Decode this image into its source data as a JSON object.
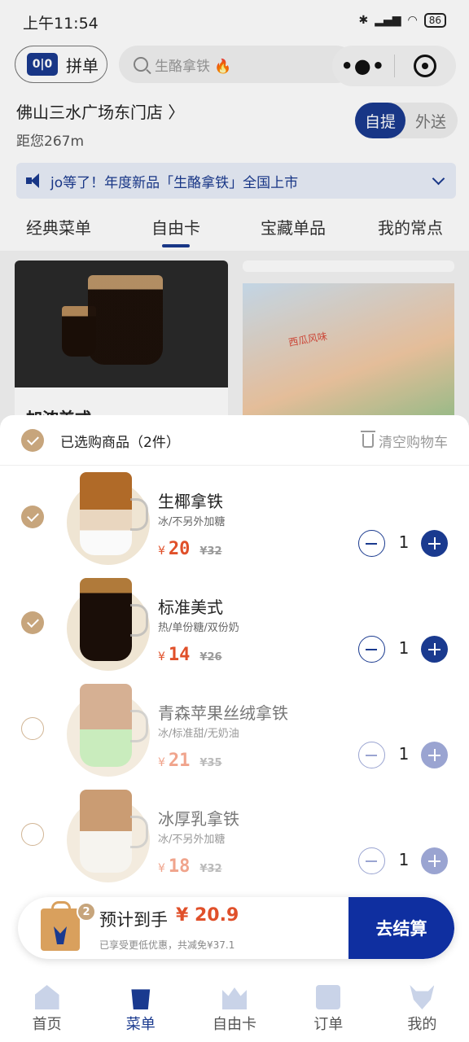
{
  "status_bar": {
    "time": "上午11:54",
    "battery": "86"
  },
  "header": {
    "pin_logo": "0|0",
    "pin_label": "拼单",
    "search_placeholder": "生酪拿铁 🔥",
    "capsule_more": "•●•",
    "store_name": "佛山三水广场东门店 〉",
    "distance": "距您267m",
    "mode_selected": "自提",
    "mode_other": "外送",
    "notice": "jo等了！年度新品「生酪拿铁」全国上市",
    "accent_color": "#1a3a8f"
  },
  "tabs": [
    {
      "label": "经典菜单"
    },
    {
      "label": "自由卡"
    },
    {
      "label": "宝藏单品"
    },
    {
      "label": "我的常点"
    }
  ],
  "background_cards": {
    "card1_name": "加浓美式",
    "card2_text": "西瓜风味"
  },
  "cart": {
    "title": "已选购商品（2件）",
    "clear_label": "清空购物车",
    "items": [
      {
        "name": "生椰拿铁",
        "spec": "冰/不另外加糖",
        "yen": "¥",
        "price": "20",
        "original": "¥32",
        "qty": "1",
        "selected": true
      },
      {
        "name": "标准美式",
        "spec": "热/单份糖/双份奶",
        "yen": "¥",
        "price": "14",
        "original": "¥26",
        "qty": "1",
        "selected": true
      },
      {
        "name": "青森苹果丝绒拿铁",
        "spec": "冰/标准甜/无奶油",
        "yen": "¥",
        "price": "21",
        "original": "¥35",
        "qty": "1",
        "selected": false
      },
      {
        "name": "冰厚乳拿铁",
        "spec": "冰/不另外加糖",
        "yen": "¥",
        "price": "18",
        "original": "¥32",
        "qty": "1",
        "selected": false
      }
    ]
  },
  "checkout": {
    "badge": "2",
    "est_label": "预计到手",
    "est_price": "¥ 20.9",
    "note": "已享受更低优惠，共减免¥37.1",
    "pay_label": "去结算"
  },
  "tabbar": [
    {
      "label": "首页",
      "icon": "home-icon"
    },
    {
      "label": "菜单",
      "icon": "menu-icon"
    },
    {
      "label": "自由卡",
      "icon": "crown-icon"
    },
    {
      "label": "订单",
      "icon": "order-icon"
    },
    {
      "label": "我的",
      "icon": "deer-icon"
    }
  ]
}
